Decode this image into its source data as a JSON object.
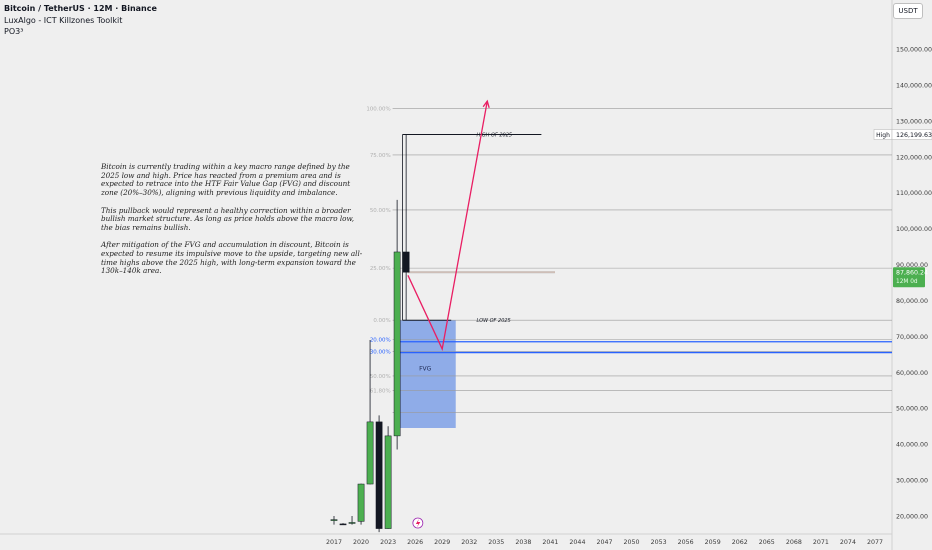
{
  "header": {
    "symbol_line": "Bitcoin / TetherUS · 12M · Binance",
    "indicator_1": "LuxAlgo - ICT Killzones Toolkit",
    "indicator_2": "PO3³"
  },
  "toolbar": {
    "currency": "USDT"
  },
  "note": {
    "p1": "Bitcoin is currently trading within a key macro range defined by the 2025 low and high. Price has reacted from a premium area and is expected to retrace into the HTF Fair Value Gap (FVG) and discount zone (20%–30%), aligning with previous liquidity and imbalance.",
    "p2": "This pullback would represent a healthy correction within a broader bullish market structure. As long as price holds above the macro low, the bias remains bullish.",
    "p3": "After mitigation of the FVG and accumulation in discount, Bitcoin is expected to resume its impulsive move to the upside, targeting new all-time highs above the 2025 high, with long-term expansion toward the 130k–140k area."
  },
  "colors": {
    "background": "#efefef",
    "bull": "#4caf50",
    "bear": "#131722",
    "fvg": "#6f96e6",
    "projection": "#e91e63",
    "level_blue": "#2962ff",
    "orange": "#c97a55",
    "price_label": "#4caf50"
  },
  "chart_data": {
    "type": "candlestick",
    "x_ticks": [
      "2017",
      "2020",
      "2023",
      "2026",
      "2029",
      "2032",
      "2035",
      "2038",
      "2041",
      "2044",
      "2047",
      "2050",
      "2053",
      "2056",
      "2059",
      "2062",
      "2065",
      "2068",
      "2071",
      "2074",
      "2077"
    ],
    "y_ticks": [
      "20,000.00",
      "30,000.00",
      "40,000.00",
      "50,000.00",
      "60,000.00",
      "70,000.00",
      "80,000.00",
      "90,000.00",
      "100,000.00",
      "110,000.00",
      "120,000.00",
      "130,000.00",
      "140,000.00",
      "150,000.00"
    ],
    "ylim": [
      17500,
      155000
    ],
    "candles": [
      {
        "year": 2017,
        "open": 19000,
        "high": 20000,
        "low": 17600,
        "close": 19000
      },
      {
        "year": 2018,
        "open": 17800,
        "high": 18000,
        "low": 17600,
        "close": 17700
      },
      {
        "year": 2019,
        "open": 18000,
        "high": 20000,
        "low": 17600,
        "close": 18200
      },
      {
        "year": 2020,
        "open": 18500,
        "high": 29000,
        "low": 17600,
        "close": 28900
      },
      {
        "year": 2021,
        "open": 28900,
        "high": 69000,
        "low": 28800,
        "close": 46200
      },
      {
        "year": 2022,
        "open": 46200,
        "high": 48000,
        "low": 15500,
        "close": 16500
      },
      {
        "year": 2023,
        "open": 16500,
        "high": 45000,
        "low": 16400,
        "close": 42300
      },
      {
        "year": 2024,
        "open": 42300,
        "high": 108000,
        "low": 38500,
        "close": 93500
      },
      {
        "year": 2025,
        "open": 93500,
        "high": 126199.63,
        "low": 74500,
        "close": 87860.24
      }
    ],
    "fvg": {
      "x_start": 2024.0,
      "x_end": 2030.5,
      "y_low": 44500,
      "y_high": 74500,
      "label": "FVG"
    },
    "levels": [
      {
        "price": 126199.63,
        "label": "HIGH OF 2025",
        "x_start": 2024.6,
        "x_end": 2040.0,
        "color": "#131722"
      },
      {
        "price": 74500,
        "label": "LOW OF 2025",
        "x_start": 2024.6,
        "x_end": 2030.0,
        "color": "#131722"
      },
      {
        "price": 68500,
        "label": "",
        "x_start": 2024.0,
        "x_end": 2080.0,
        "color": "#2962ff"
      },
      {
        "price": 65500,
        "label": "",
        "x_start": 2024.0,
        "x_end": 2080.0,
        "color": "#2962ff"
      },
      {
        "price": 87860.24,
        "label": "",
        "x_start": 2025.2,
        "x_end": 2041.5,
        "color": "#c97a55"
      }
    ],
    "fib_levels": [
      {
        "price": 133500,
        "label": "100.00%"
      },
      {
        "price": 120500,
        "label": "75.00%"
      },
      {
        "price": 105200,
        "label": "50.00%"
      },
      {
        "price": 89000,
        "label": "25.00%"
      },
      {
        "price": 74500,
        "label": "0.00%"
      },
      {
        "price": 69200,
        "label": "20.00%"
      },
      {
        "price": 65800,
        "label": "30.00%"
      },
      {
        "price": 59000,
        "label": "50.00%"
      },
      {
        "price": 55000,
        "label": "61.80%"
      },
      {
        "price": 48800,
        "label": ""
      }
    ],
    "projection": [
      {
        "x": 2025.2,
        "y": 87000
      },
      {
        "x": 2029.0,
        "y": 66500
      },
      {
        "x": 2034.0,
        "y": 135500
      }
    ],
    "price_labels": {
      "high_tag": "High",
      "high_value": "126,199.63",
      "last_price": "87,860.24",
      "countdown": "12M 0d"
    }
  }
}
